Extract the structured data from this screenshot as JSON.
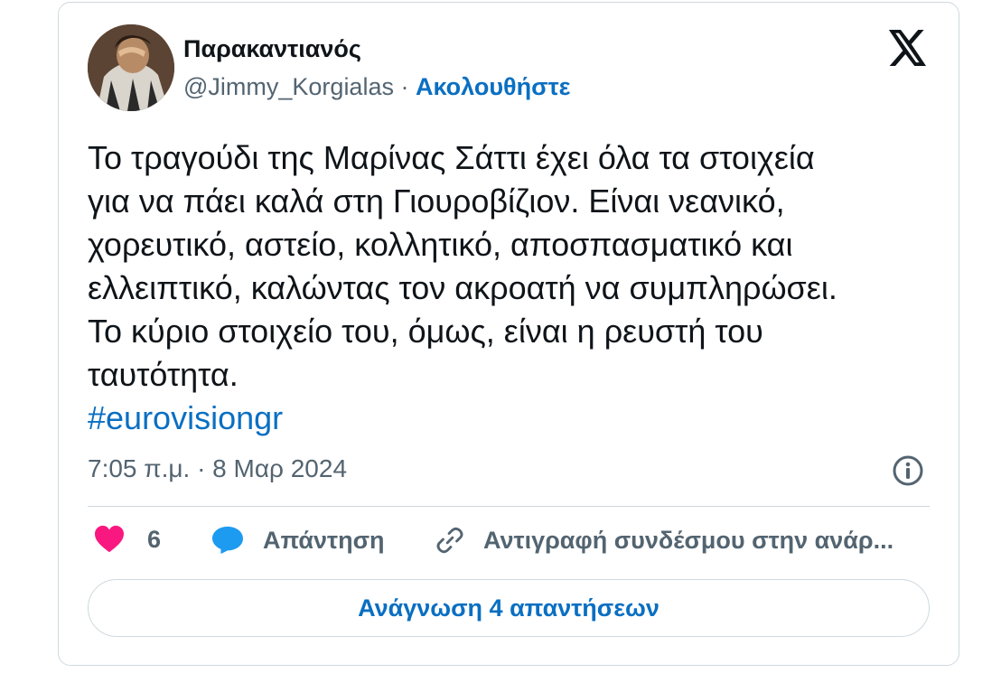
{
  "author": {
    "display_name": "Παρακαντιανός",
    "handle": "@Jimmy_Korgialas",
    "separator": "·",
    "follow_label": "Ακολουθήστε"
  },
  "brand": {
    "logo_icon": "x-logo-icon"
  },
  "tweet": {
    "text": "Το τραγούδι της Μαρίνας Σάττι έχει όλα τα στοιχεία\nγια να πάει καλά στη Γιουροβίζιον. Είναι νεανικό,\nχορευτικό, αστείο, κολλητικό, αποσπασματικό και\nελλειπτικό, καλώντας τον ακροατή να συμπληρώσει.\nΤο κύριο στοιχείο του, όμως, είναι η ρευστή του\nταυτότητα.",
    "hashtag": "#eurovisiongr",
    "timestamp": "7:05 π.μ. · 8 Μαρ 2024"
  },
  "actions": {
    "like_count": "6",
    "reply_label": "Απάντηση",
    "copy_link_label": "Αντιγραφή συνδέσμου στην ανάρ..."
  },
  "read_replies_label": "Ανάγνωση 4 απαντήσεων",
  "colors": {
    "accent": "#0a6fc2",
    "like": "#f91880",
    "reply_bubble": "#1d9bf0",
    "muted_text": "#536471",
    "border": "#cfd9de"
  }
}
